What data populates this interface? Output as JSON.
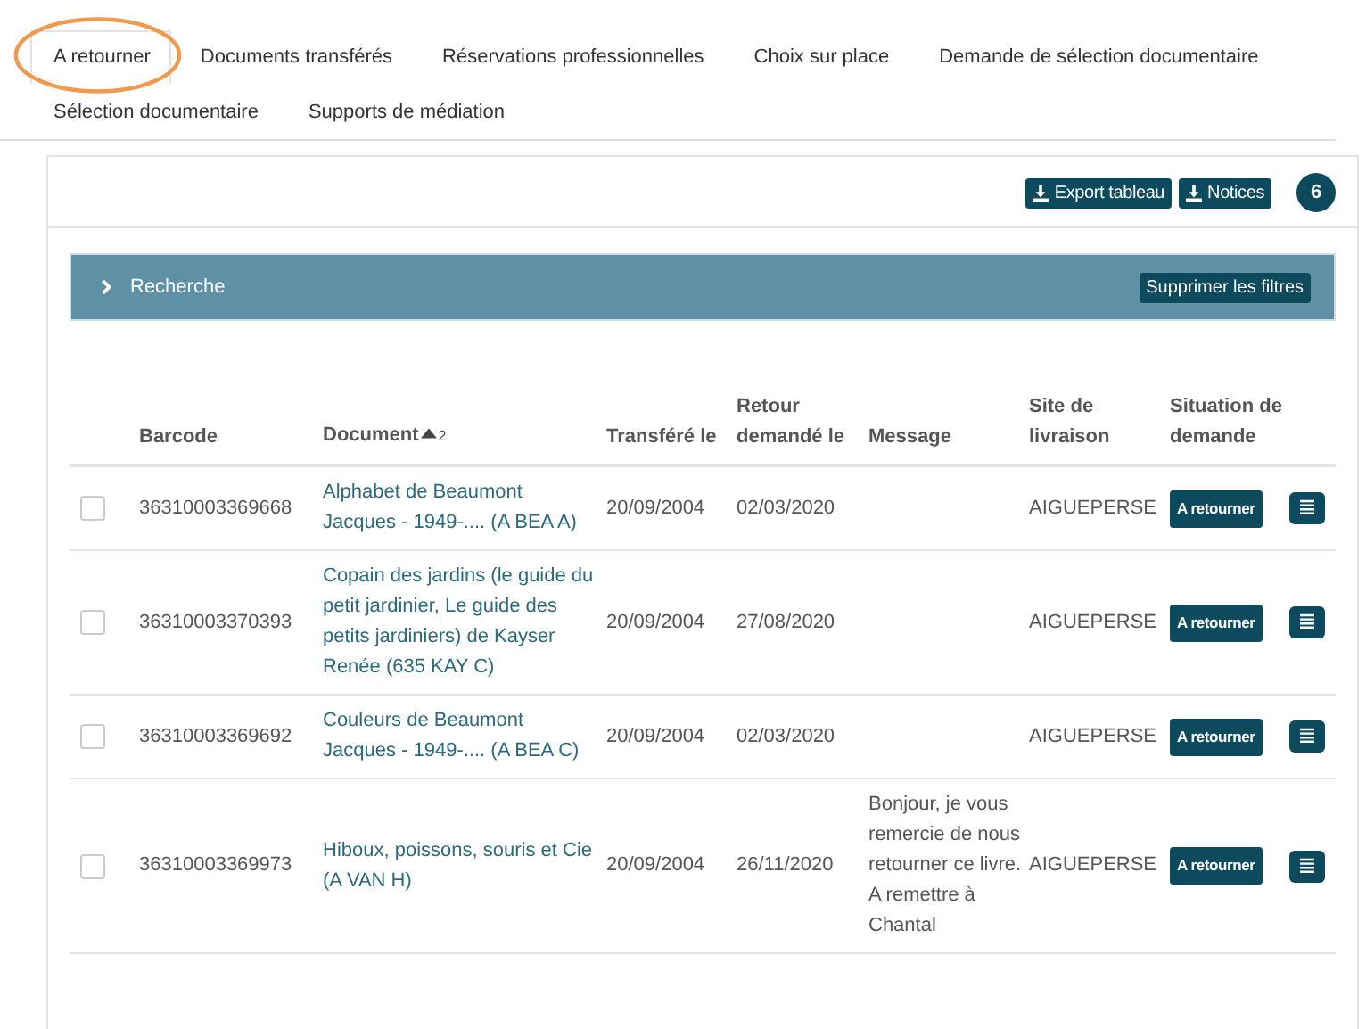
{
  "tabs": [
    {
      "label": "A retourner",
      "selected": true,
      "highlighted": true
    },
    {
      "label": "Documents transférés",
      "selected": false,
      "highlighted": false
    },
    {
      "label": "Réservations professionnelles",
      "selected": false,
      "highlighted": false
    },
    {
      "label": "Choix sur place",
      "selected": false,
      "highlighted": false
    },
    {
      "label": "Demande de sélection documentaire",
      "selected": false,
      "highlighted": false
    },
    {
      "label": "Sélection documentaire",
      "selected": false,
      "highlighted": false
    },
    {
      "label": "Supports de médiation",
      "selected": false,
      "highlighted": false
    }
  ],
  "toolbar": {
    "buttons": [
      "Export tableau",
      "Notices"
    ],
    "count": "6"
  },
  "search_panel": {
    "title": "Recherche",
    "expanded": false,
    "clear_button": "Supprimer les filtres"
  },
  "table": {
    "columns": [
      {
        "label": "Barcode",
        "sorted": false
      },
      {
        "label": "Document",
        "sorted": true,
        "sort_order": "2"
      },
      {
        "label": "Transféré le",
        "sorted": false
      },
      {
        "label": "Retour demandé le",
        "sorted": false
      },
      {
        "label": "Message",
        "sorted": false
      },
      {
        "label": "Site de livraison",
        "sorted": false
      },
      {
        "label": "Situation de demande",
        "sorted": false
      }
    ],
    "rows": [
      {
        "checked": false,
        "barcode": "36310003369668",
        "document": "Alphabet de Beaumont Jacques - 1949-.... (A BEA A)",
        "transferred": "20/09/2004",
        "return_requested": "02/03/2020",
        "message": "",
        "site": "AIGUEPERSE",
        "status": "A retourner"
      },
      {
        "checked": false,
        "barcode": "36310003370393",
        "document": "Copain des jardins (le guide du petit jardinier, Le guide des petits jardiniers) de Kayser Renée (635 KAY C)",
        "transferred": "20/09/2004",
        "return_requested": "27/08/2020",
        "message": "",
        "site": "AIGUEPERSE",
        "status": "A retourner"
      },
      {
        "checked": false,
        "barcode": "36310003369692",
        "document": "Couleurs de Beaumont Jacques - 1949-.... (A BEA C)",
        "transferred": "20/09/2004",
        "return_requested": "02/03/2020",
        "message": "",
        "site": "AIGUEPERSE",
        "status": "A retourner"
      },
      {
        "checked": false,
        "barcode": "36310003369973",
        "document": "Hiboux, poissons, souris et Cie (A VAN H)",
        "transferred": "20/09/2004",
        "return_requested": "26/11/2020",
        "message": "Bonjour, je vous remercie de nous retourner ce livre. A remettre à Chantal",
        "site": "AIGUEPERSE",
        "status": "A retourner"
      }
    ]
  }
}
